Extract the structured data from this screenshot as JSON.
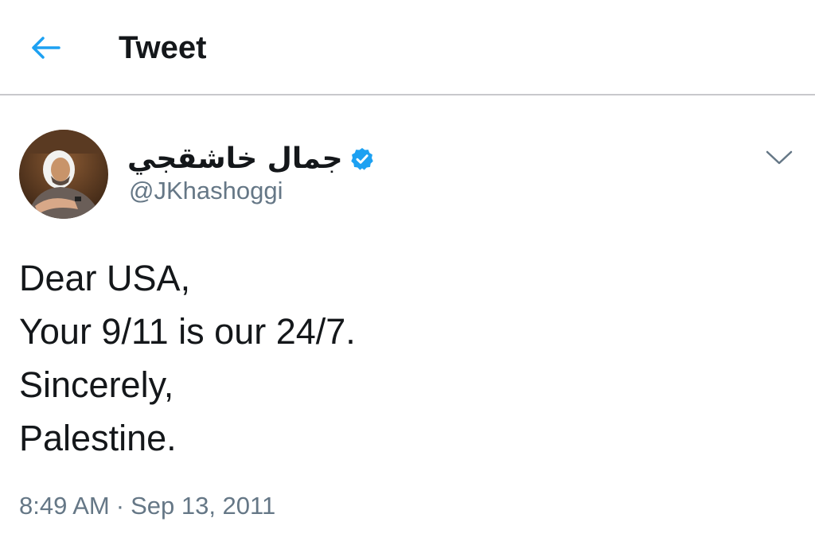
{
  "header": {
    "title": "Tweet",
    "back_icon": "arrow-left-icon",
    "accent_color": "#1da1f2"
  },
  "tweet": {
    "author": {
      "name": "جمال خاشقجي",
      "handle": "@JKhashoggi",
      "verified": true,
      "verified_icon": "verified-badge-icon"
    },
    "menu_icon": "chevron-down-icon",
    "lines": [
      "Dear USA,",
      "Your 9/11 is our 24/7.",
      "Sincerely,",
      "Palestine."
    ],
    "time": "8:49 AM",
    "separator": "·",
    "date": "Sep 13, 2011"
  },
  "colors": {
    "text": "#14171a",
    "secondary": "#657786",
    "divider": "#c8c8cc"
  }
}
